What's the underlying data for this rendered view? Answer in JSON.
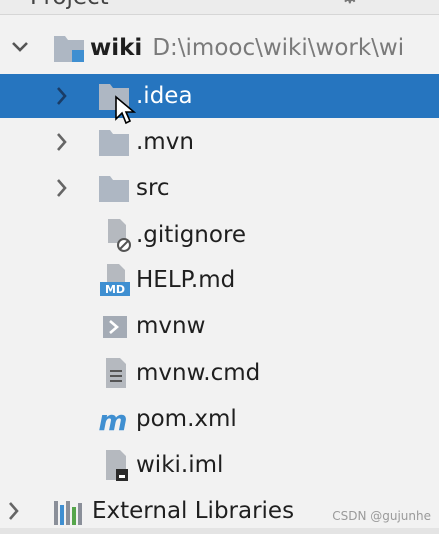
{
  "panel": {
    "title": "Project"
  },
  "root": {
    "name": "wiki",
    "path": "D:\\imooc\\wiki\\work\\wi"
  },
  "items": [
    {
      "label": ".idea",
      "type": "folder",
      "icon": "folder-icon",
      "selected": true
    },
    {
      "label": ".mvn",
      "type": "folder",
      "icon": "folder-icon"
    },
    {
      "label": "src",
      "type": "folder",
      "icon": "folder-icon"
    },
    {
      "label": ".gitignore",
      "type": "file",
      "icon": "gitignore-file-icon"
    },
    {
      "label": "HELP.md",
      "type": "file",
      "icon": "markdown-file-icon"
    },
    {
      "label": "mvnw",
      "type": "file",
      "icon": "shell-script-icon"
    },
    {
      "label": "mvnw.cmd",
      "type": "file",
      "icon": "text-file-icon"
    },
    {
      "label": "pom.xml",
      "type": "file",
      "icon": "maven-icon"
    },
    {
      "label": "wiki.iml",
      "type": "file",
      "icon": "iml-file-icon"
    }
  ],
  "external": {
    "label": "External Libraries",
    "icon": "library-icon"
  },
  "watermark": "CSDN @gujunhe",
  "colors": {
    "selection": "#2675bf",
    "folder": "#aeb7c3",
    "maven": "#3f8fd1",
    "background": "#f2f2f2"
  }
}
